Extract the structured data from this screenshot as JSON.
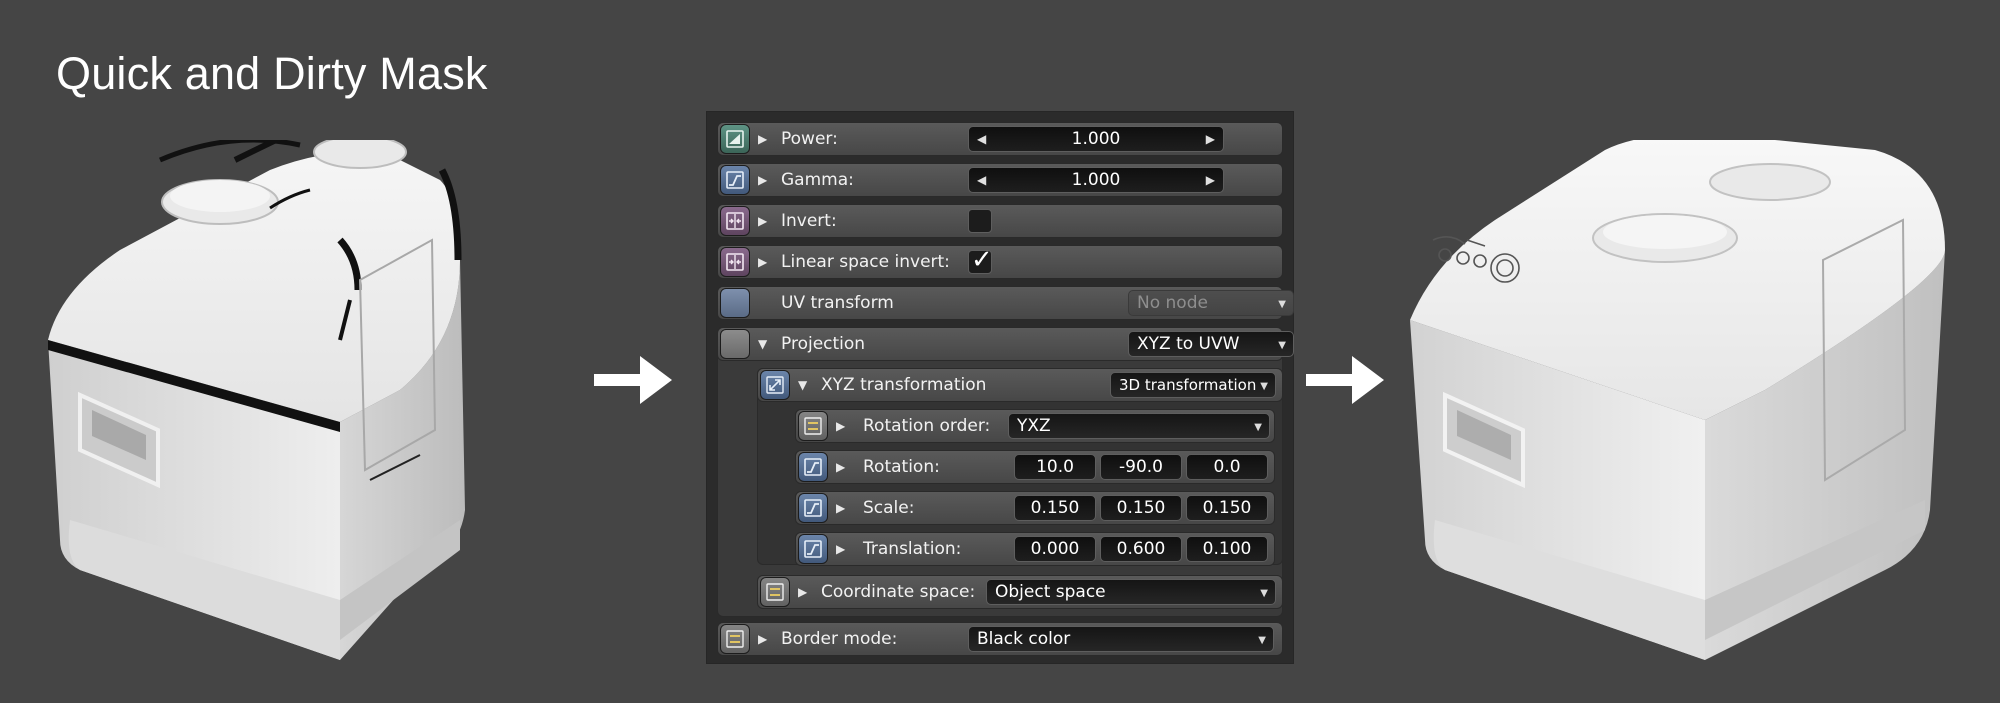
{
  "title": "Quick and Dirty Mask",
  "panel": {
    "power": {
      "label": "Power:",
      "value": "1.000"
    },
    "gamma": {
      "label": "Gamma:",
      "value": "1.000"
    },
    "invert": {
      "label": "Invert:",
      "checked": false
    },
    "linear_space_invert": {
      "label": "Linear space invert:",
      "checked": true
    },
    "uv_transform": {
      "label": "UV transform",
      "value": "No node"
    },
    "projection": {
      "label": "Projection",
      "value": "XYZ to UVW",
      "xyz_transformation": {
        "label": "XYZ transformation",
        "value": "3D transformation",
        "rotation_order": {
          "label": "Rotation order:",
          "value": "YXZ"
        },
        "rotation": {
          "label": "Rotation:",
          "values": [
            "10.0",
            "-90.0",
            "0.0"
          ]
        },
        "scale": {
          "label": "Scale:",
          "values": [
            "0.150",
            "0.150",
            "0.150"
          ]
        },
        "translation": {
          "label": "Translation:",
          "values": [
            "0.000",
            "0.600",
            "0.100"
          ]
        }
      },
      "coordinate_space": {
        "label": "Coordinate space:",
        "value": "Object space"
      }
    },
    "border_mode": {
      "label": "Border mode:",
      "value": "Black color"
    }
  },
  "icons": {
    "power": "float-texture-icon",
    "gamma": "curve-icon",
    "invert": "invert-icon",
    "uv_transform": "node-slot-icon",
    "projection": "node-slot-icon",
    "xyz_transformation": "transform-icon",
    "enum": "enum-icon"
  },
  "colors": {
    "background": "#454545",
    "panel": "#2b2b2b",
    "row": "#4e4e4e",
    "field": "#161616",
    "icon_green": "#3e6b5e",
    "icon_blue": "#4a6486",
    "icon_purple": "#6f5272",
    "icon_grey": "#7a7a7a",
    "text": "#ffffff"
  }
}
